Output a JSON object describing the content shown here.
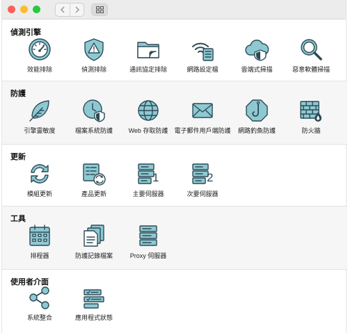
{
  "window": {
    "lights": [
      "#ff5f57",
      "#febc2e",
      "#28c840"
    ]
  },
  "sections": [
    {
      "title": "偵測引擎",
      "items": [
        {
          "label": "效能排除",
          "icon": "speedometer-icon"
        },
        {
          "label": "偵測排除",
          "icon": "warning-shield-icon"
        },
        {
          "label": "通訊協定排除",
          "icon": "network-folder-icon"
        },
        {
          "label": "網路設定檔",
          "icon": "wifi-list-icon"
        },
        {
          "label": "雲端式掃描",
          "icon": "cloud-shield-icon"
        },
        {
          "label": "惡意軟體掃描",
          "icon": "magnifier-icon"
        }
      ]
    },
    {
      "title": "防護",
      "items": [
        {
          "label": "引擎靈敏度",
          "icon": "feather-icon"
        },
        {
          "label": "檔案系統防護",
          "icon": "clock-shield-icon"
        },
        {
          "label": "Web 存取防護",
          "icon": "globe-icon"
        },
        {
          "label": "電子郵件用戶端防護",
          "icon": "envelope-icon"
        },
        {
          "label": "網路釣魚防護",
          "icon": "fishhook-icon"
        },
        {
          "label": "防火牆",
          "icon": "firewall-icon"
        }
      ]
    },
    {
      "title": "更新",
      "items": [
        {
          "label": "模組更新",
          "icon": "refresh-icon"
        },
        {
          "label": "產品更新",
          "icon": "product-update-icon"
        },
        {
          "label": "主要伺服器",
          "icon": "server-1-icon",
          "badge": "1"
        },
        {
          "label": "次要伺服器",
          "icon": "server-2-icon",
          "badge": "2"
        }
      ]
    },
    {
      "title": "工具",
      "items": [
        {
          "label": "排程器",
          "icon": "calendar-icon"
        },
        {
          "label": "防護記錄檔案",
          "icon": "log-files-icon"
        },
        {
          "label": "Proxy 伺服器",
          "icon": "proxy-server-icon"
        }
      ]
    },
    {
      "title": "使用者介面",
      "items": [
        {
          "label": "系統整合",
          "icon": "share-nodes-icon"
        },
        {
          "label": "應用程式狀態",
          "icon": "app-status-icon"
        }
      ]
    }
  ]
}
